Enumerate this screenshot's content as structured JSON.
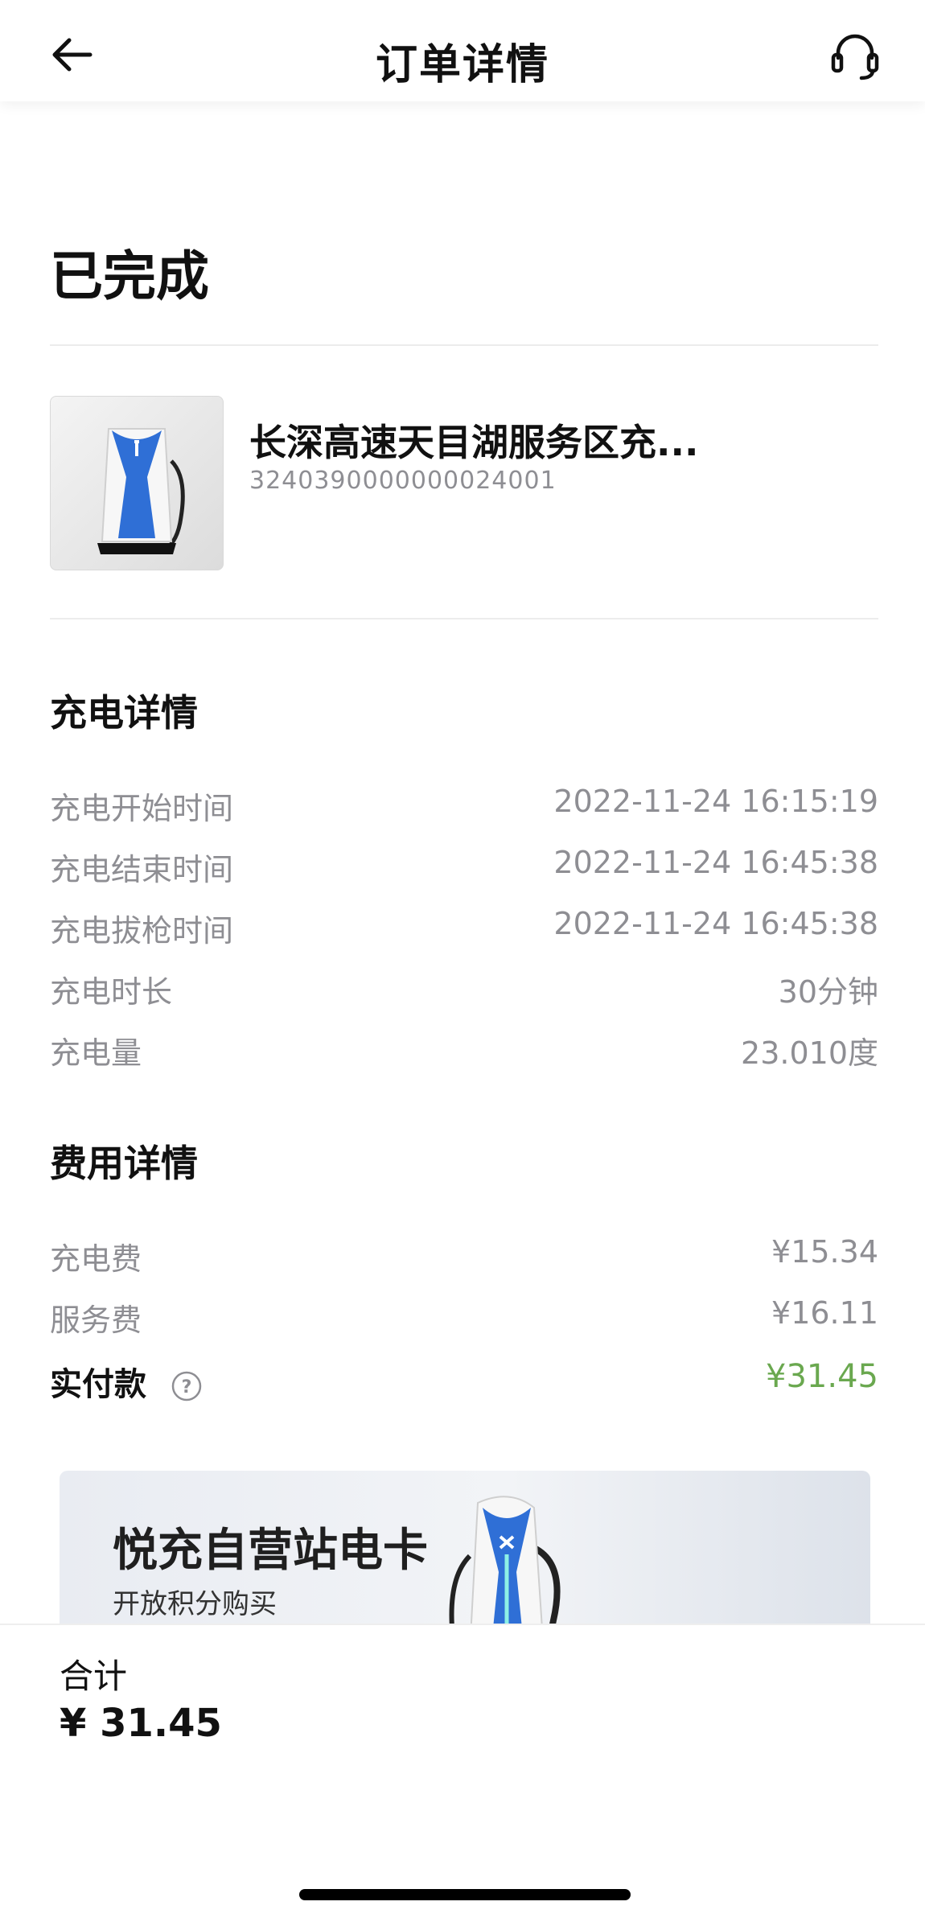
{
  "header": {
    "title": "订单详情",
    "back_icon": "arrow-left-icon",
    "support_icon": "headset-icon"
  },
  "order": {
    "status": "已完成"
  },
  "station": {
    "name": "长深高速天目湖服务区充...",
    "id": "3240390000000024001",
    "image_icon": "charger-image"
  },
  "charging": {
    "section_title": "充电详情",
    "rows": [
      {
        "label": "充电开始时间",
        "value": "2022-11-24 16:15:19"
      },
      {
        "label": "充电结束时间",
        "value": "2022-11-24 16:45:38"
      },
      {
        "label": "充电拔枪时间",
        "value": "2022-11-24 16:45:38"
      },
      {
        "label": "充电时长",
        "value": "30分钟"
      },
      {
        "label": "充电量",
        "value": "23.010度"
      }
    ]
  },
  "fees": {
    "section_title": "费用详情",
    "rows": [
      {
        "label": "充电费",
        "value": "¥15.34"
      },
      {
        "label": "服务费",
        "value": "¥16.11"
      }
    ],
    "paid": {
      "label": "实付款",
      "value": "¥31.45",
      "help_icon": "question-circle-icon"
    }
  },
  "banner": {
    "title": "悦充自营站电卡",
    "subtitle": "开放积分购买"
  },
  "footer": {
    "total_label": "合计",
    "total_value": "¥ 31.45"
  },
  "colors": {
    "accent_green": "#6aa84f",
    "muted_text": "#8e8e93",
    "charger_blue": "#2f6fd6"
  }
}
